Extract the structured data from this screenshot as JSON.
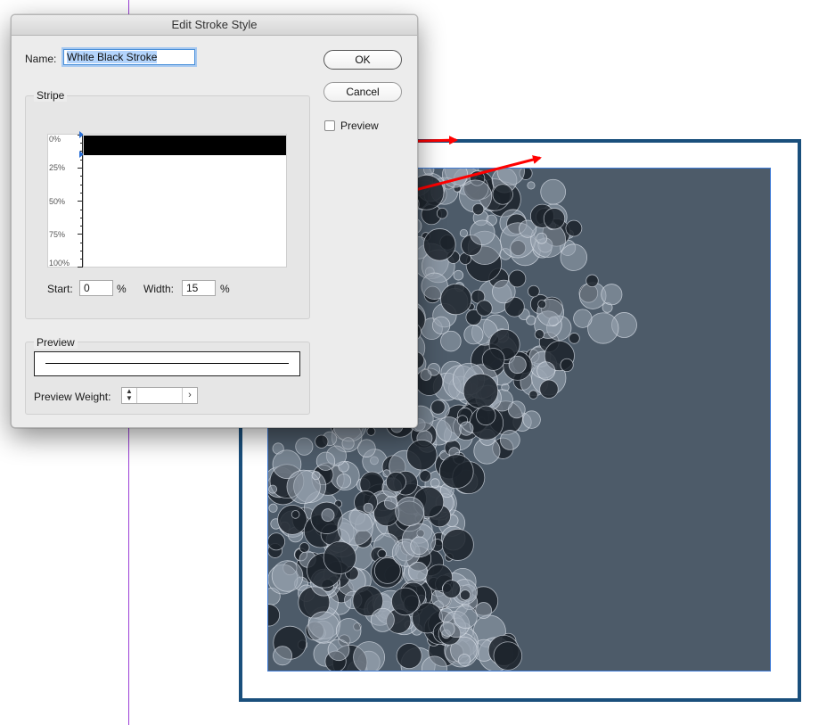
{
  "dialog": {
    "title": "Edit Stroke Style",
    "name_label": "Name:",
    "name_value": "White Black Stroke",
    "ok_label": "OK",
    "cancel_label": "Cancel",
    "preview_checkbox_label": "Preview",
    "stripe_group_title": "Stripe",
    "ruler_labels": [
      "0%",
      "25%",
      "50%",
      "75%",
      "100%"
    ],
    "stripe": {
      "start_percent": 0,
      "width_percent": 15
    },
    "start_label": "Start:",
    "start_value": "0",
    "width_label": "Width:",
    "width_value": "15",
    "percent_sign": "%",
    "preview_group_title": "Preview",
    "preview_weight_label": "Preview Weight:",
    "preview_weight_value": ""
  },
  "icons": {
    "stepper": "up-down-arrows-icon",
    "menu": "chevron-right-icon"
  },
  "colors": {
    "frame_border": "#1a4f7c",
    "image_background": "#4d5b69",
    "guide_line": "#9b3fd6",
    "arrow": "#ff0000",
    "selection_highlight": "#b3d4fc"
  }
}
